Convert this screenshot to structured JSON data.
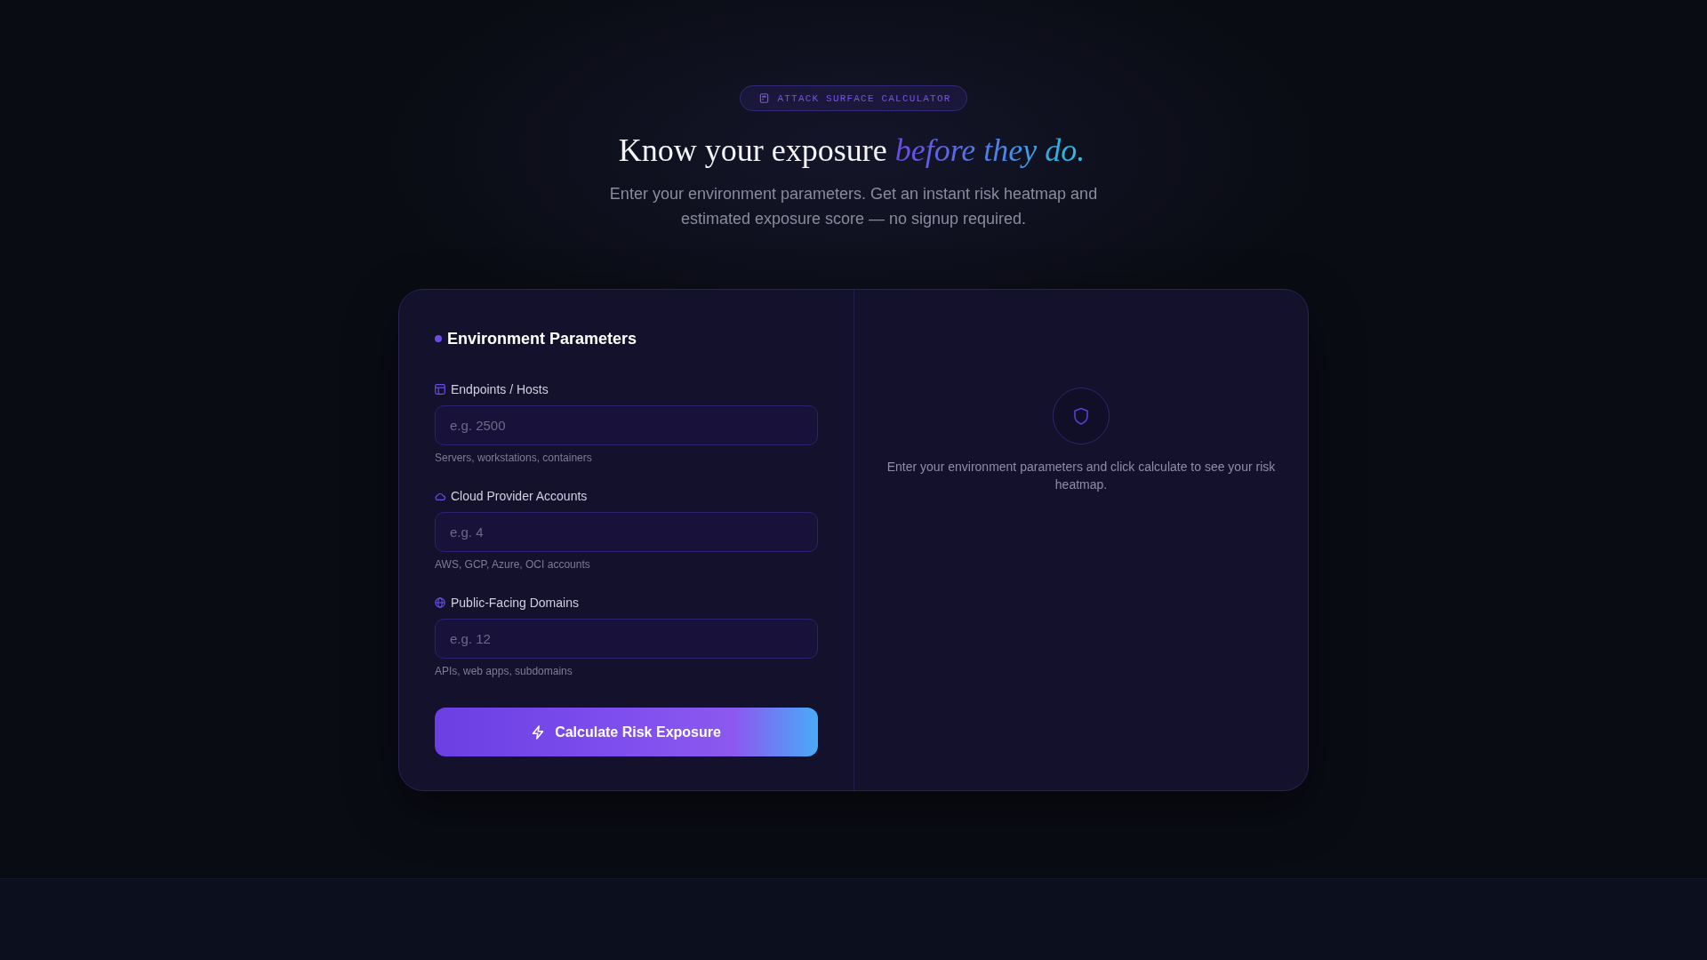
{
  "badge": {
    "label": "ATTACK SURFACE CALCULATOR"
  },
  "hero": {
    "title": "Know your exposure *before they do.*",
    "subtitle": "Enter your environment parameters. Get an instant risk heatmap and estimated exposure score — no signup required."
  },
  "form": {
    "title": "Environment Parameters",
    "fields": [
      {
        "label": "Endpoints / Hosts",
        "placeholder": "e.g. 2500",
        "hint": "Servers, workstations, containers"
      },
      {
        "label": "Cloud Provider Accounts",
        "placeholder": "e.g. 4",
        "hint": "AWS, GCP, Azure, OCI accounts"
      },
      {
        "label": "Public-Facing Domains",
        "placeholder": "e.g. 12",
        "hint": "APIs, web apps, subdomains"
      }
    ],
    "submit": "Calculate Risk Exposure"
  },
  "results": {
    "empty_message": "Enter your environment parameters and click calculate to see your risk heatmap."
  }
}
